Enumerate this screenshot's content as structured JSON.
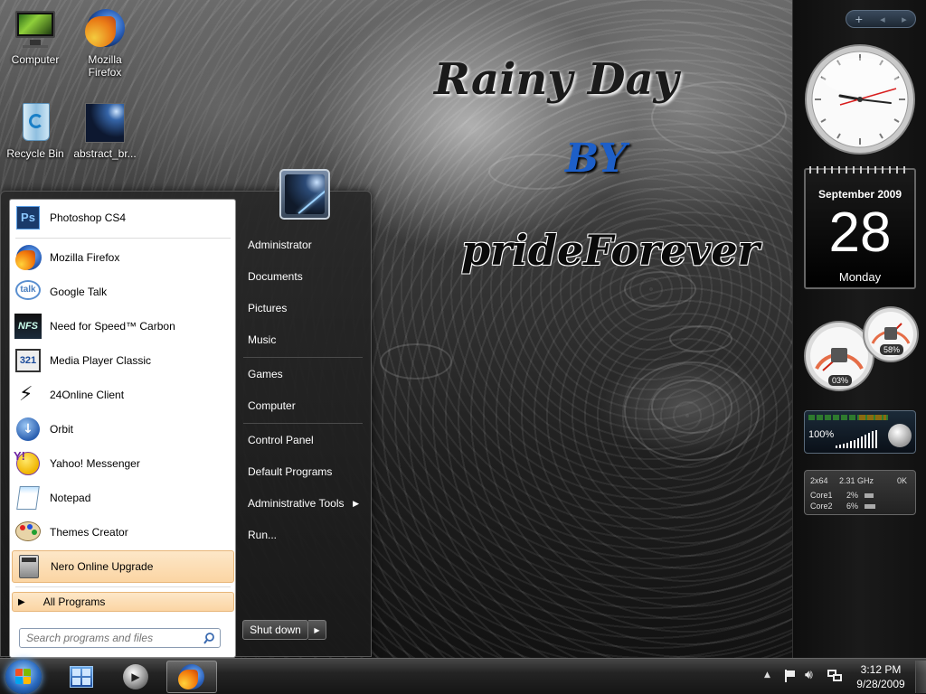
{
  "desktop": {
    "icons": [
      {
        "label": "Computer",
        "id": "computer"
      },
      {
        "label": "Mozilla\nFirefox",
        "id": "firefox"
      },
      {
        "label": "Recycle Bin",
        "id": "recycle"
      },
      {
        "label": "abstract_br...",
        "id": "abstract"
      }
    ],
    "wallpaper_text": {
      "line1": "Rainy Day",
      "line2": "BY",
      "line3": "prideForever"
    }
  },
  "start_menu": {
    "pinned": [
      {
        "label": "Photoshop CS4",
        "icon": "photoshop-icon"
      },
      {
        "label": "Mozilla Firefox",
        "icon": "firefox-icon"
      },
      {
        "label": "Google Talk",
        "icon": "google-talk-icon"
      },
      {
        "label": "Need for Speed™ Carbon",
        "icon": "nfs-icon"
      },
      {
        "label": "Media Player Classic",
        "icon": "media-player-icon"
      },
      {
        "label": "24Online Client",
        "icon": "24online-icon"
      },
      {
        "label": "Orbit",
        "icon": "orbit-icon"
      },
      {
        "label": "Yahoo! Messenger",
        "icon": "yahoo-icon"
      },
      {
        "label": "Notepad",
        "icon": "notepad-icon"
      },
      {
        "label": "Themes Creator",
        "icon": "themes-creator-icon"
      },
      {
        "label": "Nero Online Upgrade",
        "icon": "nero-icon"
      }
    ],
    "all_programs": "All Programs",
    "search_placeholder": "Search programs and files",
    "right_items": [
      {
        "label": "Administrator"
      },
      {
        "label": "Documents"
      },
      {
        "label": "Pictures"
      },
      {
        "label": "Music"
      },
      {
        "label": "Games"
      },
      {
        "label": "Computer"
      },
      {
        "label": "Control Panel"
      },
      {
        "label": "Default Programs"
      },
      {
        "label": "Administrative Tools"
      },
      {
        "label": "Run..."
      }
    ],
    "shutdown": "Shut down"
  },
  "gadgets": {
    "calendar": {
      "month_year": "September 2009",
      "day": "28",
      "weekday": "Monday"
    },
    "cpu_meter": {
      "cpu": "03%",
      "ram": "58%"
    },
    "volume": {
      "level": "100%"
    },
    "cpu_info": {
      "arch": "2x64",
      "speed": "2.31 GHz",
      "extra": "0K",
      "core1_label": "Core1",
      "core1": "2%",
      "core2_label": "Core2",
      "core2": "6%"
    }
  },
  "taskbar": {
    "time": "3:12 PM",
    "date": "9/28/2009"
  },
  "colors": {
    "accent": "#fbd5a3",
    "taskbar": "#151515",
    "sidebar": "#141414"
  }
}
